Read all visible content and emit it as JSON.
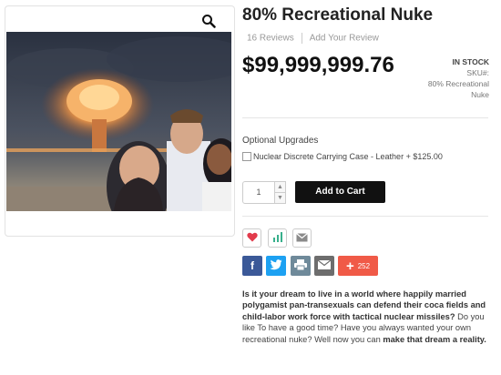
{
  "product": {
    "title": "80% Recreational Nuke",
    "reviews_label": "16 Reviews",
    "add_review_label": "Add Your Review",
    "price": "$99,999,999.76",
    "stock_label": "IN STOCK",
    "sku_label": "SKU#:",
    "sku_value_line1": "80% Recreational",
    "sku_value_line2": "Nuke"
  },
  "options": {
    "title": "Optional Upgrades",
    "item_label": "Nuclear Discrete Carrying Case - Leather + $125.00"
  },
  "cart": {
    "quantity": "1",
    "add_label": "Add to Cart"
  },
  "share": {
    "plus_count": "252"
  },
  "description": {
    "bold1": "Is it your dream to live in a world where happily married polygamist pan-transexuals can defend their coca fields and child-labor work force with tactical nuclear missiles?",
    "normal1": " Do you like To have a good time? Have you always wanted your own recreational nuke? Well now you can ",
    "bold2": "make that dream a reality."
  },
  "colors": {
    "facebook": "#3b5998",
    "twitter": "#1da1f2",
    "print": "#6f8a9a",
    "email": "#6d6d6d",
    "plus": "#f05a47",
    "heart": "#e23b4c",
    "chart": "#38b08c"
  },
  "icons": [
    "search-icon",
    "heart-icon",
    "chart-icon",
    "email-icon",
    "facebook-icon",
    "twitter-icon",
    "print-icon",
    "plus-icon"
  ]
}
